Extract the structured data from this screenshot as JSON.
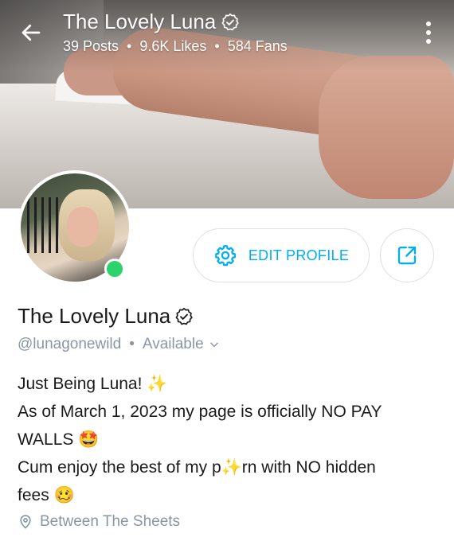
{
  "header": {
    "title": "The Lovely Luna",
    "stats": {
      "posts": "39 Posts",
      "likes": "9.6K Likes",
      "fans": "584 Fans",
      "separator": "•"
    }
  },
  "profile": {
    "edit_label": "EDIT PROFILE",
    "name": "The Lovely Luna",
    "handle": "@lunagonewild",
    "separator": "•",
    "status": "Available",
    "bio_lines": [
      {
        "text": "Just Being Luna! ",
        "emoji": "✨"
      },
      {
        "text": "As of March 1, 2023 my page is officially NO PAY"
      },
      {
        "text": "WALLS ",
        "emoji": "🤩"
      },
      {
        "pre": "Cum enjoy the best of my p",
        "emoji": "✨",
        "post": "rn with NO hidden"
      },
      {
        "text": "fees ",
        "emoji": "🥴"
      }
    ],
    "location": "Between The Sheets"
  },
  "colors": {
    "accent": "#00aff0",
    "muted": "#8a96a3",
    "online": "#2bd36a"
  },
  "icons": {
    "back": "arrow-left-icon",
    "more": "vertical-dots-icon",
    "verified": "verified-badge-icon",
    "settings": "gear-icon",
    "share": "share-icon",
    "dropdown": "chevron-down-icon",
    "location": "location-pin-icon"
  }
}
